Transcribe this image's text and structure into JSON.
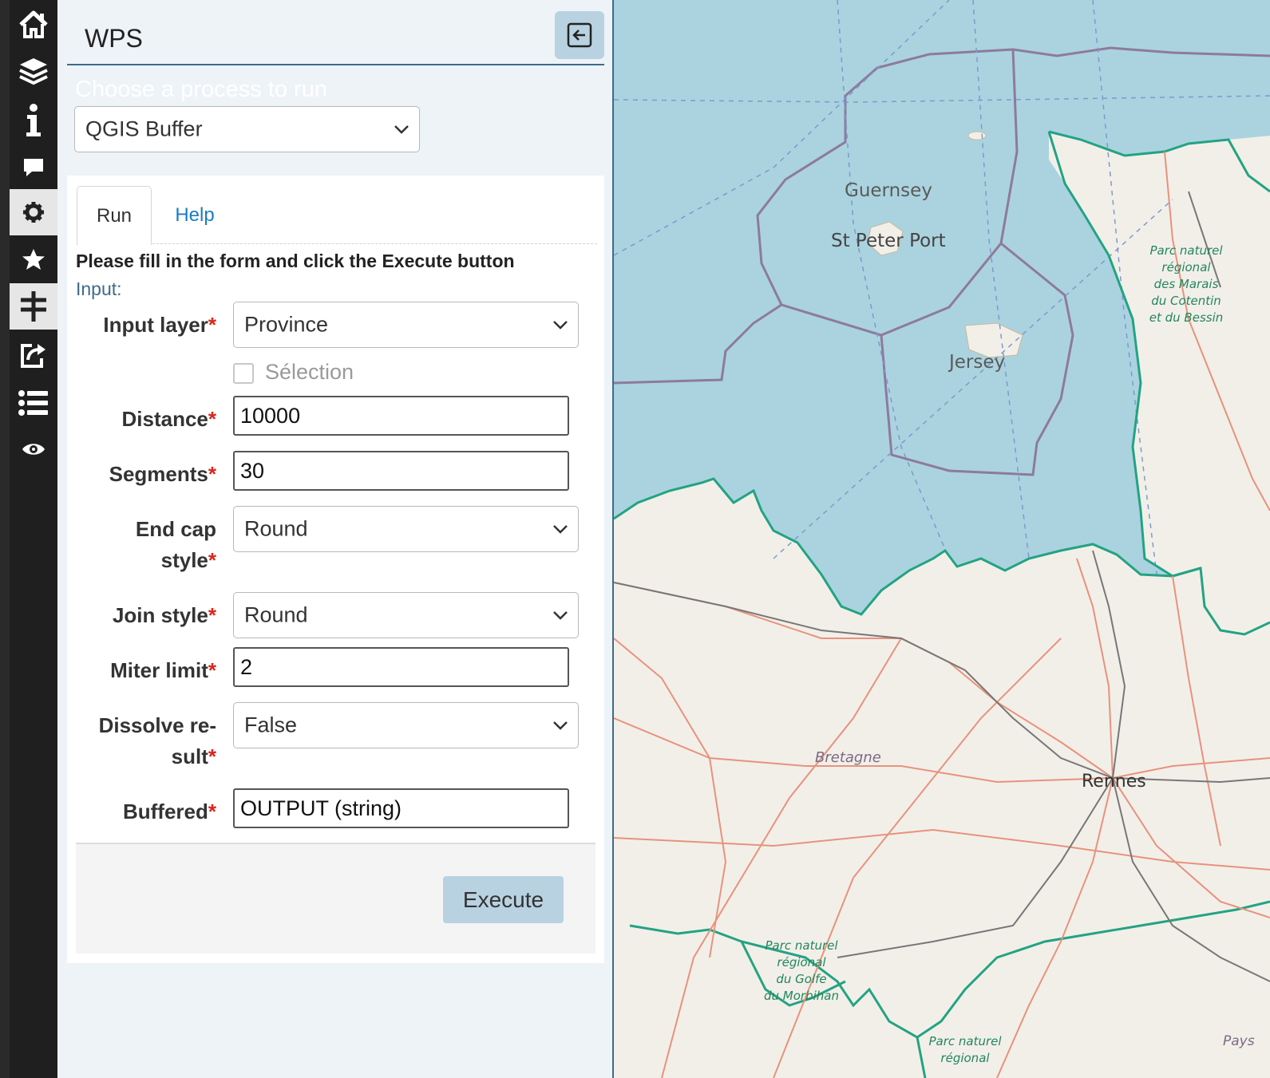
{
  "panel": {
    "title": "WPS",
    "choose_label": "Choose a process to run",
    "process_selected": "QGIS Buffer"
  },
  "tabs": [
    {
      "label": "Run",
      "active": true
    },
    {
      "label": "Help",
      "active": false
    }
  ],
  "form": {
    "instructions": "Please fill in the form and click the Execute button",
    "input_heading": "Input:",
    "required_marker": "*",
    "fields": {
      "input_layer": {
        "label": "Input layer",
        "value": "Province"
      },
      "selection": {
        "label": "Sélection",
        "checked": false
      },
      "distance": {
        "label": "Distance",
        "value": "10000"
      },
      "segments": {
        "label": "Segments",
        "value": "30"
      },
      "end_cap_style": {
        "label_line1": "End cap",
        "label_line2": "style",
        "value": "Round"
      },
      "join_style": {
        "label": "Join style",
        "value": "Round"
      },
      "miter_limit": {
        "label": "Miter limit",
        "value": "2"
      },
      "dissolve_result": {
        "label_line1": "Dissolve re-",
        "label_line2": "sult",
        "value": "False"
      },
      "buffered": {
        "label": "Buffered",
        "value": "OUTPUT (string)"
      }
    },
    "execute_label": "Execute"
  },
  "toolbar": {
    "items": [
      {
        "icon": "home-icon",
        "active": false
      },
      {
        "icon": "layers-icon",
        "active": false
      },
      {
        "icon": "info-icon",
        "active": false
      },
      {
        "icon": "comment-icon",
        "active": false
      },
      {
        "icon": "gear-icon",
        "active": true
      },
      {
        "icon": "star-icon",
        "active": false
      },
      {
        "icon": "processing-icon",
        "active": true
      },
      {
        "icon": "share-icon",
        "active": false
      },
      {
        "icon": "list-icon",
        "active": false
      },
      {
        "icon": "eye-icon",
        "active": false
      }
    ]
  },
  "map": {
    "labels": {
      "guernsey": "Guernsey",
      "st_peter_port": "St Peter Port",
      "jersey": "Jersey",
      "parc_cotentin": [
        "Parc naturel",
        "régional",
        "des Marais",
        "du Cotentin",
        "et du Bessin"
      ],
      "bretagne": "Bretagne",
      "rennes": "Rennes",
      "parc_morbihan": [
        "Parc naturel",
        "régional",
        "du Golfe",
        "du Morbihan"
      ],
      "parc_bottom": [
        "Parc naturel",
        "régional"
      ],
      "pays": "Pays"
    },
    "colors": {
      "sea": "#aad3df",
      "land": "#f2efe9",
      "boundary": "#23a383",
      "maritime": "#8e7a9c",
      "road": "#e8927c"
    }
  }
}
